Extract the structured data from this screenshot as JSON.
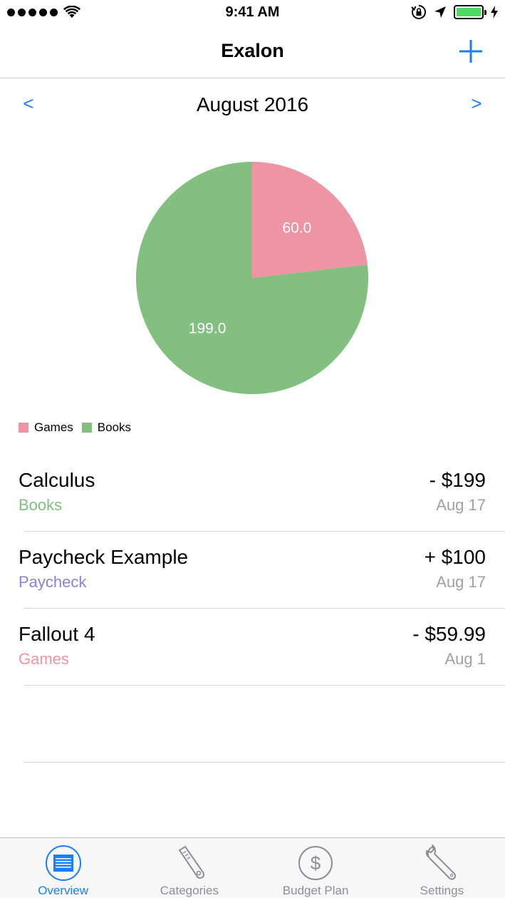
{
  "status_bar": {
    "time": "9:41 AM",
    "signal_bars": 5,
    "icons": [
      "wifi-icon",
      "rotation-lock-icon",
      "location-arrow-icon",
      "battery-icon",
      "charging-bolt-icon"
    ],
    "battery_level": 1.0
  },
  "nav": {
    "title": "Exalon",
    "add_icon": "plus-icon"
  },
  "month": {
    "prev_label": "<",
    "label": "August 2016",
    "next_label": ">"
  },
  "chart_data": {
    "type": "pie",
    "slices": [
      {
        "label": "Games",
        "value": 60.0,
        "display": "60.0",
        "color": "#ef94a4"
      },
      {
        "label": "Books",
        "value": 199.0,
        "display": "199.0",
        "color": "#82bf80"
      }
    ],
    "legend": [
      "Games",
      "Books"
    ],
    "legend_position": "bottom-left"
  },
  "transactions": [
    {
      "name": "Calculus",
      "category": "Books",
      "category_color": "#82bf80",
      "amount": "- $199",
      "date": "Aug 17"
    },
    {
      "name": "Paycheck Example",
      "category": "Paycheck",
      "category_color": "#8b82d6",
      "amount": "+ $100",
      "date": "Aug 17"
    },
    {
      "name": "Fallout 4",
      "category": "Games",
      "category_color": "#ef94a4",
      "amount": "- $59.99",
      "date": "Aug 1"
    }
  ],
  "tabs": [
    {
      "label": "Overview",
      "icon": "overview-list-icon",
      "active": true
    },
    {
      "label": "Categories",
      "icon": "tag-icon",
      "active": false
    },
    {
      "label": "Budget Plan",
      "icon": "dollar-circle-icon",
      "active": false
    },
    {
      "label": "Settings",
      "icon": "wrench-icon",
      "active": false
    }
  ],
  "colors": {
    "accent": "#1a7ef5",
    "tab_inactive": "#8e8e93",
    "secondary_text": "#a0a0a8"
  }
}
